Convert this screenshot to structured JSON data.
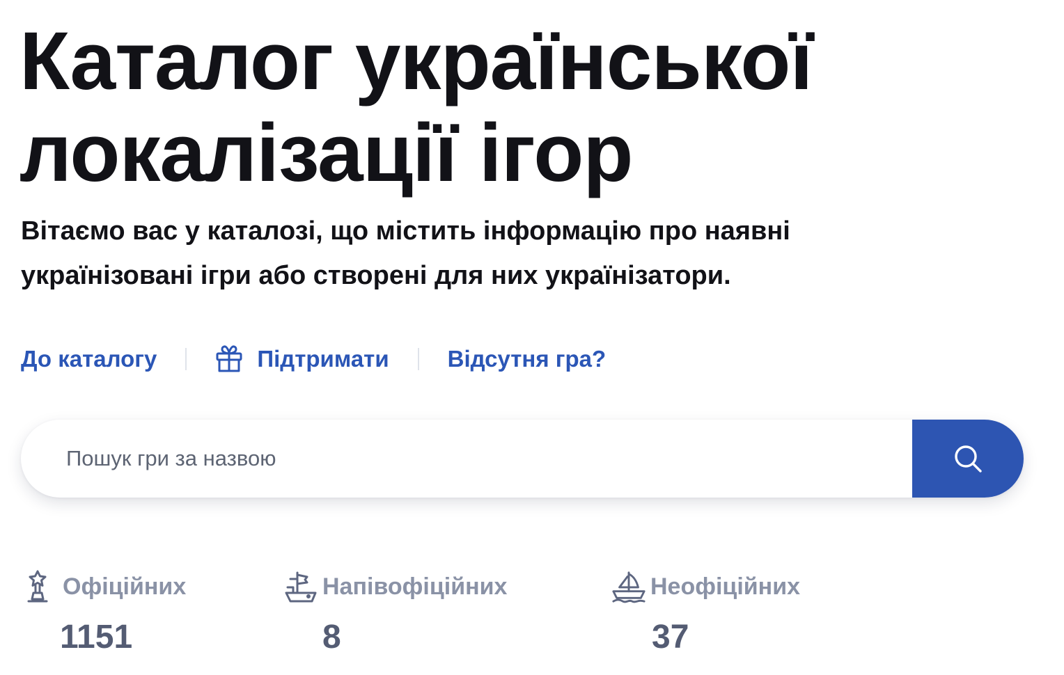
{
  "hero": {
    "title_line1": "Каталог української",
    "title_line2": "локалізації ігор",
    "intro_line1": "Вітаємо вас у каталозі, що містить інформацію про наявні",
    "intro_line2": "українізовані ігри або створені для них українізатори."
  },
  "actions": {
    "catalog_label": "До каталогу",
    "support_label": "Підтримати",
    "support_icon": "gift-icon",
    "missing_game_label": "Відсутня гра?",
    "link_color": "#2b56b6"
  },
  "search": {
    "placeholder": "Пошук гри за назвою",
    "button_icon": "search-icon",
    "button_color": "#2d55b2"
  },
  "stats": [
    {
      "label": "Офіційних",
      "count": "1151",
      "icon": "award-icon"
    },
    {
      "label": "Напівофіційних",
      "count": "8",
      "icon": "ship-icon"
    },
    {
      "label": "Неофіційних",
      "count": "37",
      "icon": "boat-icon"
    }
  ]
}
